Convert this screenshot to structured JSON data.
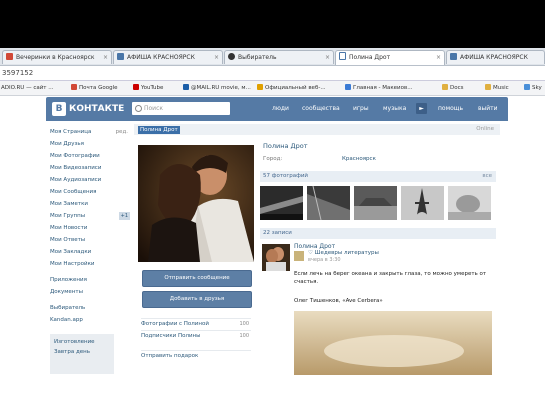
{
  "browser": {
    "tabs": [
      {
        "label": "Вечеринки в Красноярск",
        "icon": "vk-icon",
        "color": "#d14836"
      },
      {
        "label": "АФИША КРАСНОЯРСК",
        "icon": "afisha-icon",
        "color": "#4a76a8"
      },
      {
        "label": "Выбиратель",
        "icon": "paw-icon",
        "color": "#333333"
      },
      {
        "label": "Полина Дрот",
        "icon": "page-icon",
        "color": "#4a76a8"
      },
      {
        "label": "АФИША КРАСНОЯРСК",
        "icon": "afisha-icon",
        "color": "#4a76a8"
      }
    ],
    "close_glyph": "×",
    "address_fragment": "3597152",
    "bookmarks": [
      {
        "label": "ADIO.RU — сайт ...",
        "icon": "site-icon",
        "color": "#888888"
      },
      {
        "label": "Почта Google",
        "icon": "gmail-icon",
        "color": "#d14836"
      },
      {
        "label": "YouTube",
        "icon": "youtube-icon",
        "color": "#cc0000"
      },
      {
        "label": "@MAIL.RU movie, м...",
        "icon": "mail-icon",
        "color": "#1c5fa8"
      },
      {
        "label": "Официальный веб-...",
        "icon": "site-icon",
        "color": "#e0a000"
      },
      {
        "label": "Главная - Макеиов...",
        "icon": "site-icon",
        "color": "#3a7bd5"
      },
      {
        "label": "Docs",
        "icon": "folder-icon",
        "color": "#e0b040"
      },
      {
        "label": "Music",
        "icon": "folder-icon",
        "color": "#e0b040"
      },
      {
        "label": "Sky",
        "icon": "site-icon",
        "color": "#4a90d9"
      }
    ]
  },
  "vk": {
    "logo_letter": "В",
    "logo_text": "КОНТАКТЕ",
    "search_placeholder": "Поиск",
    "nav": [
      "люди",
      "сообщества",
      "игры",
      "музыка",
      "помощь",
      "выйти"
    ],
    "nav_arrow": "►",
    "colors": {
      "header": "#557aa5",
      "link": "#2b587a"
    }
  },
  "leftnav": {
    "items": [
      {
        "label": "Моя Страница",
        "right": "ред."
      },
      {
        "label": "Мои Друзья",
        "right": ""
      },
      {
        "label": "Мои Фотографии",
        "right": ""
      },
      {
        "label": "Мои Видеозаписи",
        "right": ""
      },
      {
        "label": "Мои Аудиозаписи",
        "right": ""
      },
      {
        "label": "Мои Сообщения",
        "right": ""
      },
      {
        "label": "Мои Заметки",
        "right": ""
      },
      {
        "label": "Мои Группы",
        "right": "+1",
        "pill": true
      },
      {
        "label": "Мои Новости",
        "right": ""
      },
      {
        "label": "Мои Ответы",
        "right": ""
      },
      {
        "label": "Мои Закладки",
        "right": ""
      },
      {
        "label": "Мои Настройки",
        "right": ""
      }
    ],
    "apps": [
      "Приложения",
      "Документы"
    ],
    "extras": [
      "Выбиратель",
      "Kandan.app"
    ],
    "ads": [
      "Изготовление",
      "Завтра день"
    ]
  },
  "profile": {
    "name_tag": "Полина Дрот",
    "online": "Online",
    "name": "Полина Дрот",
    "city_label": "Город:",
    "city_value": "Красноярск",
    "send_message": "Отправить сообщение",
    "add_friend": "Добавить в друзья",
    "links": [
      {
        "label": "Фотографии с Полиной",
        "right": "100"
      },
      {
        "label": "Подписчики Полины",
        "right": "100"
      },
      {
        "label": "Отправить подарок",
        "right": ""
      }
    ],
    "photos_header": "57 фотографий",
    "photos_right": "все",
    "wall_header": "22 записи"
  },
  "post": {
    "author": "Полина Дрот",
    "group": "♡ Шедевры литературы",
    "time": "вчера в 3:30",
    "text": "Если лечь на берег океана и закрыть глаза, то можно умереть от счастья.",
    "author_line": "Олег Тишенков, «Ave Cerbera»"
  }
}
